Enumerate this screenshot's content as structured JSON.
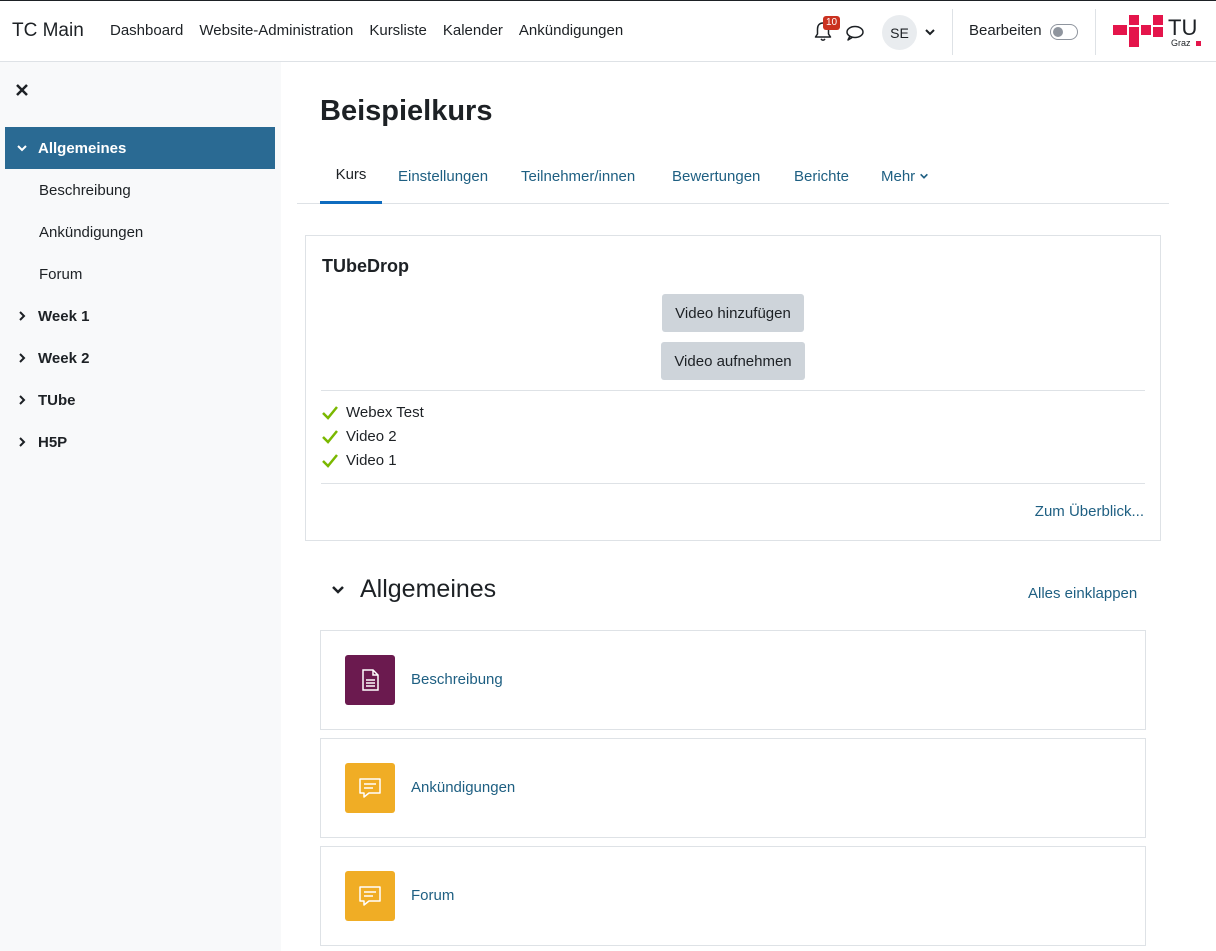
{
  "navbar": {
    "site_name": "TC Main",
    "links": [
      "Dashboard",
      "Website-Administration",
      "Kursliste",
      "Kalender",
      "Ankündigungen"
    ],
    "notification_count": "10",
    "avatar_initials": "SE",
    "edit_label": "Bearbeiten",
    "logo_text": "TU",
    "logo_subtext": "Graz"
  },
  "drawer": {
    "items": [
      {
        "label": "Allgemeines",
        "type": "section",
        "expanded": true,
        "active": true
      },
      {
        "label": "Beschreibung",
        "type": "sub"
      },
      {
        "label": "Ankündigungen",
        "type": "sub"
      },
      {
        "label": "Forum",
        "type": "sub"
      },
      {
        "label": "Week 1",
        "type": "section",
        "expanded": false
      },
      {
        "label": "Week 2",
        "type": "section",
        "expanded": false
      },
      {
        "label": "TUbe",
        "type": "section",
        "expanded": false
      },
      {
        "label": "H5P",
        "type": "section",
        "expanded": false
      }
    ]
  },
  "course": {
    "title": "Beispielkurs",
    "tabs": [
      "Kurs",
      "Einstellungen",
      "Teilnehmer/innen",
      "Bewertungen",
      "Berichte",
      "Mehr"
    ]
  },
  "tubedrop": {
    "title": "TUbeDrop",
    "add_video": "Video hinzufügen",
    "record_video": "Video aufnehmen",
    "videos": [
      "Webex Test",
      "Video 2",
      "Video 1"
    ],
    "overview_link": "Zum Überblick..."
  },
  "section": {
    "name": "Allgemeines",
    "collapse_all": "Alles einklappen",
    "activities": [
      {
        "name": "Beschreibung",
        "icon": "page-icon",
        "color": "#6b1a4f"
      },
      {
        "name": "Ankündigungen",
        "icon": "forum-icon",
        "color": "#f0ad25"
      },
      {
        "name": "Forum",
        "icon": "forum-icon",
        "color": "#f0ad25"
      }
    ]
  },
  "colors": {
    "accent": "#2a6a93",
    "link": "#1e5f82",
    "tab_active": "#0f6cbf",
    "badge": "#ca3120",
    "logo_red": "#e4154b"
  }
}
